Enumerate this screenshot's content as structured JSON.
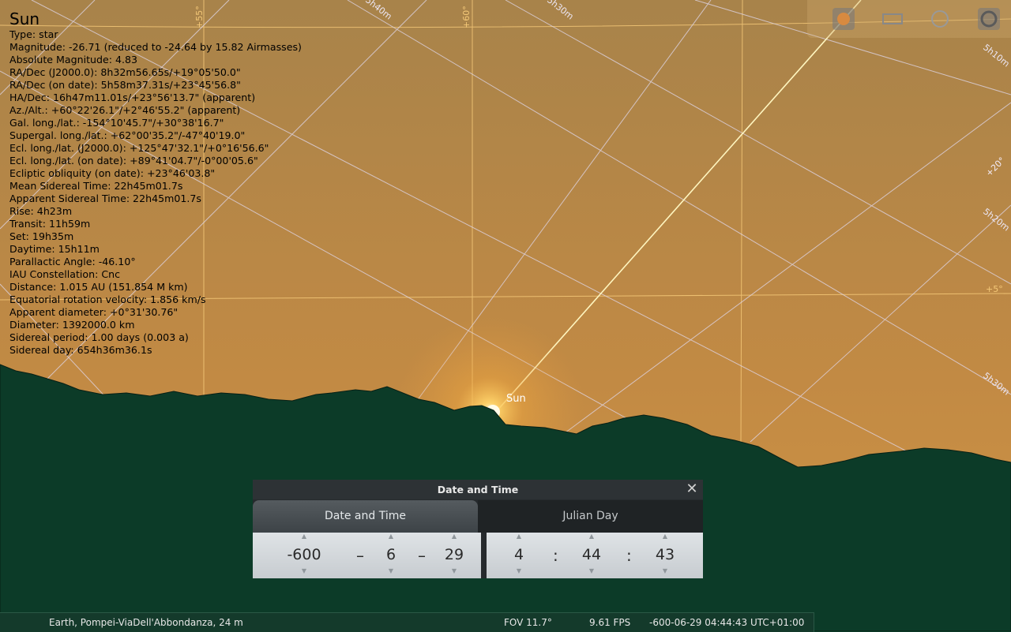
{
  "object": {
    "name": "Sun",
    "lines": [
      "Type: star",
      "Magnitude: -26.71 (reduced to -24.64 by 15.82 Airmasses)",
      "Absolute Magnitude: 4.83",
      "RA/Dec (J2000.0): 8h32m56.65s/+19°05'50.0\"",
      "RA/Dec (on date): 5h58m37.31s/+23°45'56.8\"",
      "HA/Dec: 16h47m11.01s/+23°56'13.7\" (apparent)",
      "Az./Alt.: +60°22'26.1\"/+2°46'55.2\" (apparent)",
      "Gal. long./lat.: -154°10'45.7\"/+30°38'16.7\"",
      "Supergal. long./lat.: +62°00'35.2\"/-47°40'19.0\"",
      "Ecl. long./lat. (J2000.0): +125°47'32.1\"/+0°16'56.6\"",
      "Ecl. long./lat. (on date): +89°41'04.7\"/-0°00'05.6\"",
      "Ecliptic obliquity (on date): +23°46'03.8\"",
      "Mean Sidereal Time: 22h45m01.7s",
      "Apparent Sidereal Time: 22h45m01.7s",
      "Rise: 4h23m",
      "Transit: 11h59m",
      "Set: 19h35m",
      "Daytime: 15h11m",
      "Parallactic Angle: -46.10°",
      "IAU Constellation: Cnc",
      "Distance: 1.015 AU (151.854 M km)",
      "Equatorial rotation velocity: 1.856 km/s",
      "Apparent diameter: +0°31'30.76\"",
      "Diameter: 1392000.0 km",
      "Sidereal period: 1.00 days (0.003 a)",
      "Sidereal day: 654h36m36.1s"
    ],
    "sky_label": "Sun"
  },
  "grid_labels": {
    "alt": [
      "+55°",
      "+60°",
      "+65°",
      "+5°",
      "+20°",
      "+25°",
      "+30°",
      "+10°",
      "+45°"
    ],
    "ra": [
      "5h50m",
      "5h40m",
      "5h30m",
      "5h20m",
      "5h10m",
      "5h10m",
      "5h20m",
      "5h30m",
      "5h50m"
    ]
  },
  "toolbar": {
    "icons": [
      "sun-icon",
      "rectangle-icon",
      "moon-icon",
      "settings-icon"
    ]
  },
  "datetime_window": {
    "title": "Date and Time",
    "close_symbol": "✕",
    "tabs": [
      "Date and Time",
      "Julian Day"
    ],
    "active_tab": 0,
    "date": {
      "year": "-600",
      "month": "6",
      "day": "29",
      "sep": "–"
    },
    "time": {
      "hour": "4",
      "minute": "44",
      "second": "43",
      "sep": ":"
    },
    "arrow_up": "▲",
    "arrow_down": "▼"
  },
  "status": {
    "location": "Earth, Pompei-ViaDell'Abbondanza, 24 m",
    "fov": "FOV 11.7°",
    "fps": "9.61 FPS",
    "datetime": "-600-06-29 04:44:43 UTC+01:00"
  },
  "colors": {
    "sky_top": "#a8834a",
    "sky_horizon": "#c78f42",
    "ground": "#0c3b28",
    "grid_alt": "#f0c070",
    "grid_ra": "#d8d0e8",
    "ecliptic": "#fff4b0"
  }
}
